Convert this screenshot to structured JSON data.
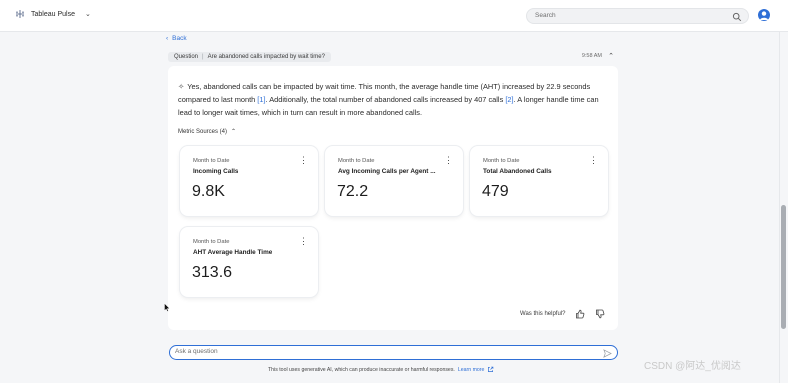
{
  "app": {
    "name": "Tableau Pulse"
  },
  "search": {
    "placeholder": "Search"
  },
  "nav": {
    "back_label": "Back"
  },
  "question": {
    "label": "Question",
    "text": "Are abandoned calls impacted by wait time?",
    "time": "9:58 AM"
  },
  "answer": {
    "part1": "Yes, abandoned calls can be impacted by wait time. This month, the average handle time (AHT) increased by 22.9 seconds compared to last month ",
    "cite1": "[1]",
    "part2": ". Additionally, the total number of abandoned calls increased by 407 calls ",
    "cite2": "[2]",
    "part3": ". A longer handle time can lead to longer wait times, which in turn can result in more abandoned calls."
  },
  "metric_sources": {
    "label": "Metric Sources (4)"
  },
  "metrics": [
    {
      "context": "Month to Date",
      "title": "Incoming Calls",
      "value": "9.8K"
    },
    {
      "context": "Month to Date",
      "title": "Avg Incoming Calls per Agent ...",
      "value": "72.2"
    },
    {
      "context": "Month to Date",
      "title": "Total Abandoned Calls",
      "value": "479"
    },
    {
      "context": "Month to Date",
      "title": "AHT Average Handle Time",
      "value": "313.6"
    }
  ],
  "feedback": {
    "label": "Was this helpful?"
  },
  "ask": {
    "placeholder": "Ask a question"
  },
  "disclaimer": {
    "text": "This tool uses generative AI, which can produce inaccurate or harmful responses.",
    "learn_more": "Learn more"
  },
  "watermark": "CSDN @阿达_优阅达",
  "colors": {
    "accent": "#2f6fd6",
    "background": "#f5f6f8",
    "card": "#ffffff"
  }
}
